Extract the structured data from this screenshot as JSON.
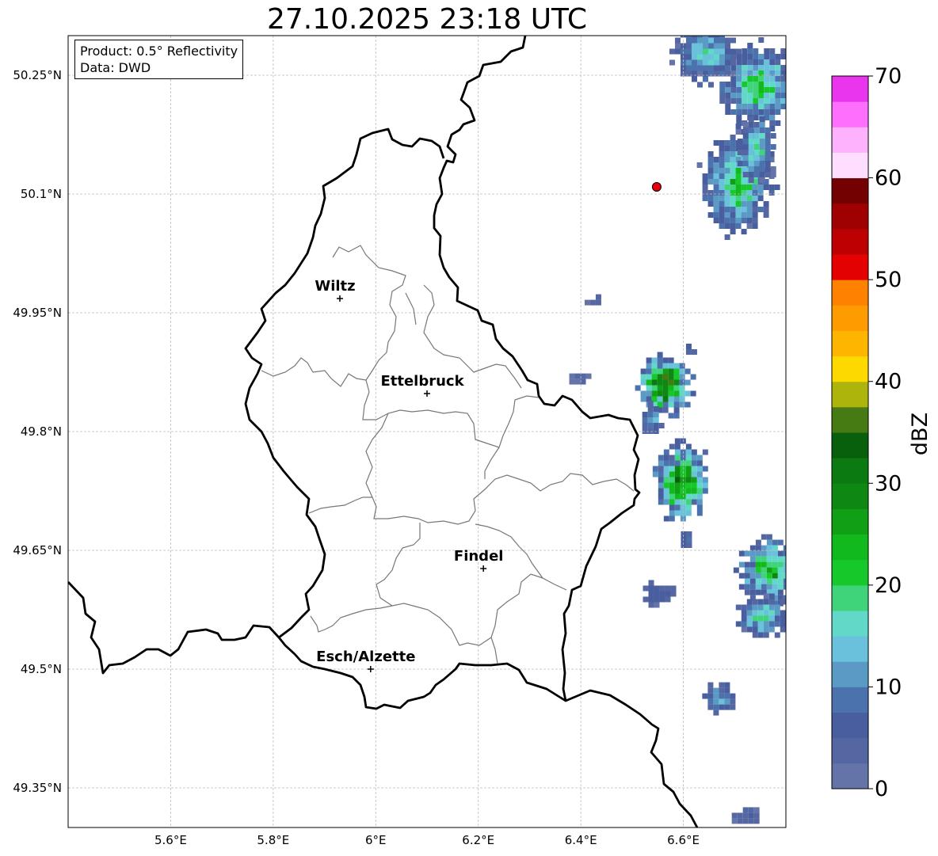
{
  "title": "27.10.2025 23:18 UTC",
  "info": {
    "product": "Product: 0.5° Reflectivity",
    "source": "Data: DWD"
  },
  "map": {
    "lon_range": [
      5.4,
      6.8
    ],
    "lat_range": [
      49.3,
      50.3
    ],
    "lon_ticks": [
      5.6,
      5.8,
      6.0,
      6.2,
      6.4,
      6.6
    ],
    "lon_tick_labels": [
      "5.6°E",
      "5.8°E",
      "6°E",
      "6.2°E",
      "6.4°E",
      "6.6°E"
    ],
    "lat_ticks": [
      50.25,
      50.1,
      49.95,
      49.8,
      49.65,
      49.5,
      49.35
    ],
    "lat_tick_labels": [
      "50.25°N",
      "50.1°N",
      "49.95°N",
      "49.8°N",
      "49.65°N",
      "49.5°N",
      "49.35°N"
    ],
    "grid": true,
    "cities": [
      {
        "name": "Wiltz",
        "lon": 5.93,
        "lat": 49.968
      },
      {
        "name": "Ettelbruck",
        "lon": 6.1,
        "lat": 49.848
      },
      {
        "name": "Findel",
        "lon": 6.21,
        "lat": 49.627
      },
      {
        "name": "Esch/Alzette",
        "lon": 5.99,
        "lat": 49.5
      }
    ],
    "radar_site": {
      "lon": 6.548,
      "lat": 50.109,
      "color": "#e8000b"
    }
  },
  "colorbar": {
    "label": "dBZ",
    "min": 0,
    "max": 70,
    "step": 2.5,
    "ticks": [
      0,
      10,
      20,
      30,
      40,
      50,
      60,
      70
    ],
    "tick_labels": [
      "0",
      "10",
      "20",
      "30",
      "40",
      "50",
      "60",
      "70"
    ],
    "colors": [
      "#6474a8",
      "#5567a2",
      "#485e9e",
      "#4b72ac",
      "#5a9ac4",
      "#69c1dc",
      "#62d8c8",
      "#3fd47a",
      "#16c82a",
      "#12b91c",
      "#119f15",
      "#0e8812",
      "#0b7a10",
      "#09600c",
      "#467a12",
      "#adb50c",
      "#fdd900",
      "#fdb500",
      "#fe9b00",
      "#fe8100",
      "#e40101",
      "#bd0102",
      "#9f0102",
      "#740101",
      "#fedefe",
      "#feb2fe",
      "#fe6ffe",
      "#ea35ee"
    ]
  },
  "precip_cells": [
    {
      "lon": 6.74,
      "lat": 50.24,
      "rx": 0.07,
      "ry": 0.05,
      "peak": 24
    },
    {
      "lon": 6.64,
      "lat": 50.28,
      "rx": 0.06,
      "ry": 0.035,
      "peak": 18
    },
    {
      "lon": 6.7,
      "lat": 50.118,
      "rx": 0.065,
      "ry": 0.06,
      "peak": 24
    },
    {
      "lon": 6.74,
      "lat": 50.16,
      "rx": 0.035,
      "ry": 0.04,
      "peak": 20
    },
    {
      "lon": 6.56,
      "lat": 49.862,
      "rx": 0.05,
      "ry": 0.035,
      "peak": 38
    },
    {
      "lon": 6.535,
      "lat": 49.82,
      "rx": 0.02,
      "ry": 0.02,
      "peak": 15
    },
    {
      "lon": 6.59,
      "lat": 49.74,
      "rx": 0.055,
      "ry": 0.045,
      "peak": 32
    },
    {
      "lon": 6.765,
      "lat": 49.628,
      "rx": 0.06,
      "ry": 0.038,
      "peak": 28
    },
    {
      "lon": 6.75,
      "lat": 49.57,
      "rx": 0.045,
      "ry": 0.025,
      "peak": 22
    },
    {
      "lon": 6.545,
      "lat": 49.6,
      "rx": 0.035,
      "ry": 0.015,
      "peak": 8
    },
    {
      "lon": 6.665,
      "lat": 49.467,
      "rx": 0.03,
      "ry": 0.018,
      "peak": 16
    },
    {
      "lon": 6.72,
      "lat": 49.317,
      "rx": 0.028,
      "ry": 0.012,
      "peak": 6
    },
    {
      "lon": 6.42,
      "lat": 49.97,
      "rx": 0.018,
      "ry": 0.008,
      "peak": 6
    },
    {
      "lon": 6.39,
      "lat": 49.87,
      "rx": 0.018,
      "ry": 0.008,
      "peak": 6
    },
    {
      "lon": 6.61,
      "lat": 49.905,
      "rx": 0.012,
      "ry": 0.01,
      "peak": 6
    },
    {
      "lon": 6.6,
      "lat": 49.668,
      "rx": 0.012,
      "ry": 0.01,
      "peak": 15
    }
  ]
}
